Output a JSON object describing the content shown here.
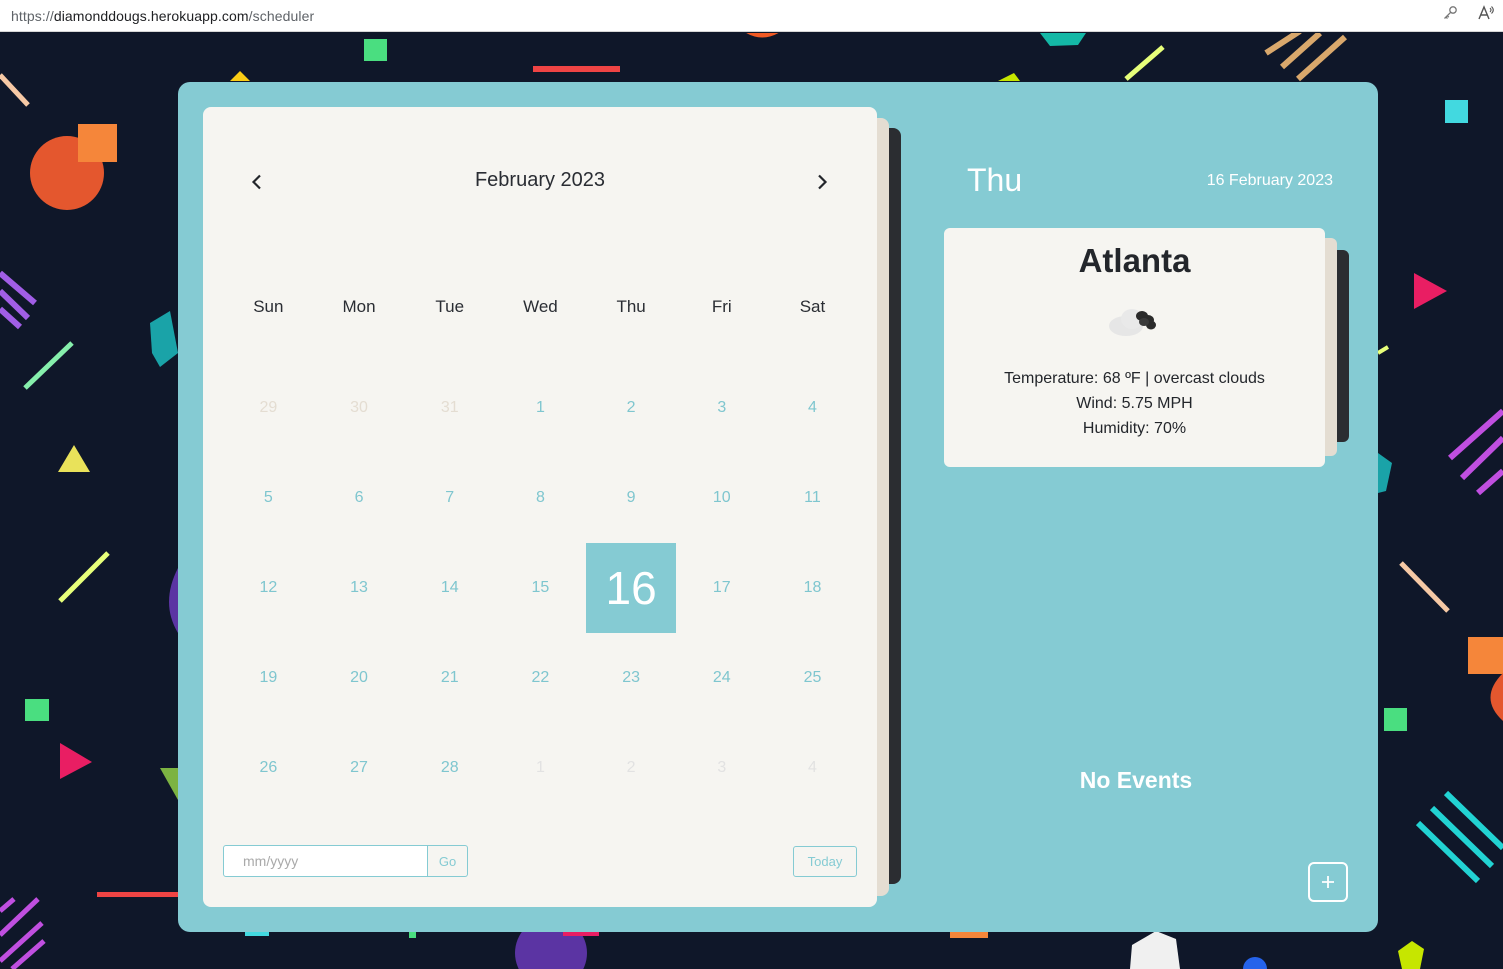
{
  "browser": {
    "url_scheme": "https://",
    "url_host": "diamonddougs.herokuapp.com",
    "url_path": "/scheduler"
  },
  "calendar": {
    "month_title": "February 2023",
    "weekdays": [
      "Sun",
      "Mon",
      "Tue",
      "Wed",
      "Thu",
      "Fri",
      "Sat"
    ],
    "days": [
      {
        "label": "29",
        "kind": "prev-month"
      },
      {
        "label": "30",
        "kind": "prev-month"
      },
      {
        "label": "31",
        "kind": "prev-month"
      },
      {
        "label": "1",
        "kind": "current"
      },
      {
        "label": "2",
        "kind": "current"
      },
      {
        "label": "3",
        "kind": "current"
      },
      {
        "label": "4",
        "kind": "current"
      },
      {
        "label": "5",
        "kind": "current"
      },
      {
        "label": "6",
        "kind": "current"
      },
      {
        "label": "7",
        "kind": "current"
      },
      {
        "label": "8",
        "kind": "current"
      },
      {
        "label": "9",
        "kind": "current"
      },
      {
        "label": "10",
        "kind": "current"
      },
      {
        "label": "11",
        "kind": "current"
      },
      {
        "label": "12",
        "kind": "current"
      },
      {
        "label": "13",
        "kind": "current"
      },
      {
        "label": "14",
        "kind": "current"
      },
      {
        "label": "15",
        "kind": "current"
      },
      {
        "label": "16",
        "kind": "selected"
      },
      {
        "label": "17",
        "kind": "current"
      },
      {
        "label": "18",
        "kind": "current"
      },
      {
        "label": "19",
        "kind": "current"
      },
      {
        "label": "20",
        "kind": "current"
      },
      {
        "label": "21",
        "kind": "current"
      },
      {
        "label": "22",
        "kind": "current"
      },
      {
        "label": "23",
        "kind": "current"
      },
      {
        "label": "24",
        "kind": "current"
      },
      {
        "label": "25",
        "kind": "current"
      },
      {
        "label": "26",
        "kind": "current"
      },
      {
        "label": "27",
        "kind": "current"
      },
      {
        "label": "28",
        "kind": "current"
      },
      {
        "label": "1",
        "kind": "next-month"
      },
      {
        "label": "2",
        "kind": "next-month"
      },
      {
        "label": "3",
        "kind": "next-month"
      },
      {
        "label": "4",
        "kind": "next-month"
      }
    ],
    "date_input_placeholder": "mm/yyyy",
    "go_label": "Go",
    "today_label": "Today"
  },
  "selected_day": {
    "day_name": "Thu",
    "full_date": "16 February 2023"
  },
  "weather": {
    "city": "Atlanta",
    "icon": "overcast-clouds-icon",
    "temperature": "Temperature: 68 ºF | overcast clouds",
    "wind": "Wind: 5.75 MPH",
    "humidity": "Humidity: 70%"
  },
  "events": {
    "empty_label": "No Events"
  },
  "colors": {
    "background": "#0f1729",
    "accent": "#85cbd3",
    "panel": "#f6f5f1",
    "text_dark": "#23262b"
  }
}
